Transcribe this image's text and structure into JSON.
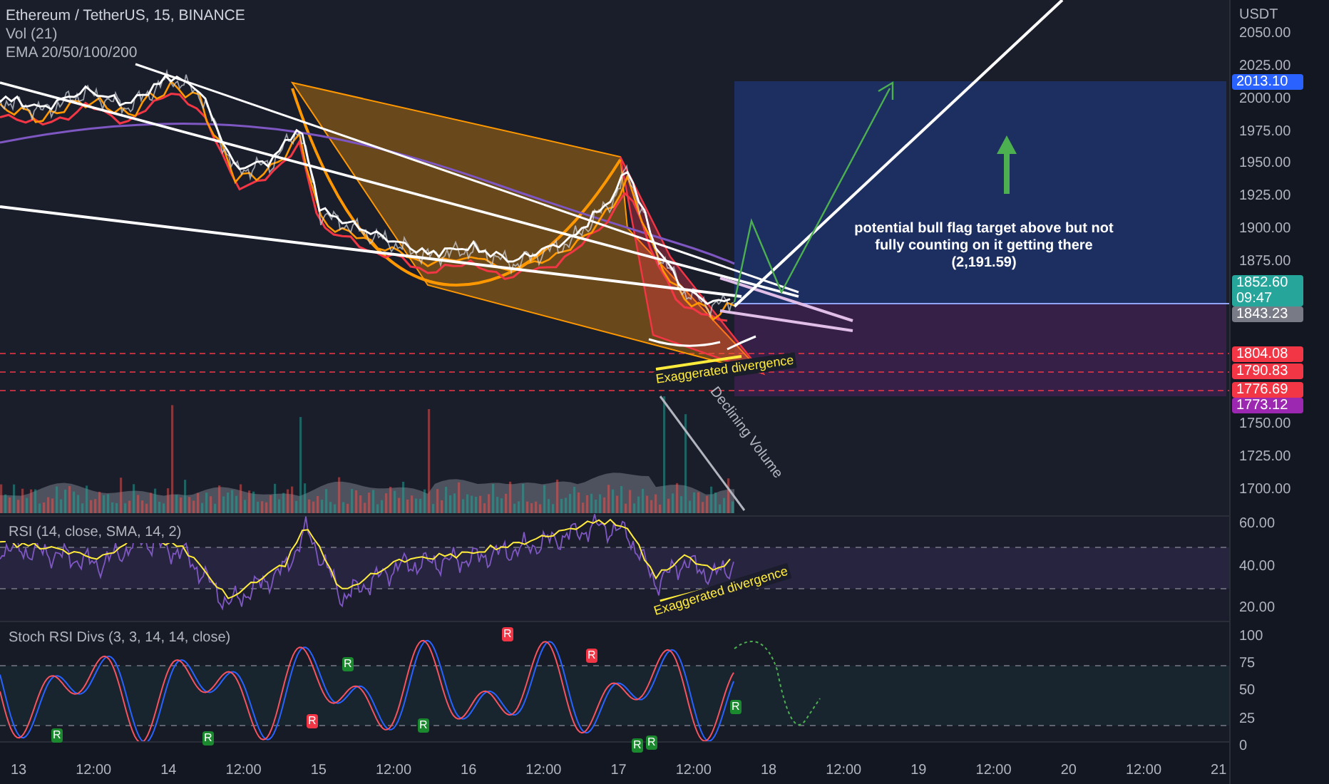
{
  "legend": {
    "title": "Ethereum / TetherUS, 15, BINANCE",
    "indicators": [
      "Vol (21)",
      "EMA 20/50/100/200"
    ]
  },
  "price_axis": {
    "currency": "USDT",
    "ticks": [
      "2050.00",
      "2025.00",
      "2000.00",
      "1975.00",
      "1950.00",
      "1925.00",
      "1900.00",
      "1875.00",
      "1750.00",
      "1725.00",
      "1700.00"
    ]
  },
  "price_badges": [
    {
      "text": "2013.10",
      "color": "#2962ff"
    },
    {
      "text": "1852.60",
      "subtext": "09:47",
      "color": "#26a69a"
    },
    {
      "text": "1843.23",
      "color": "#787b86"
    },
    {
      "text": "1804.08",
      "color": "#f23645"
    },
    {
      "text": "1790.83",
      "color": "#f23645"
    },
    {
      "text": "1776.69",
      "color": "#f23645"
    },
    {
      "text": "1773.12",
      "color": "#9c27b0"
    }
  ],
  "annotations": [
    {
      "kind": "note",
      "lines": [
        "potential bull flag target above but not",
        "fully counting on it getting there",
        "(2,191.59)"
      ]
    },
    {
      "kind": "divergence",
      "text": "Exaggerated divergence"
    },
    {
      "kind": "volume",
      "text": "Declining Volume"
    },
    {
      "kind": "rsi-divergence",
      "text": "Exaggerated divergence"
    }
  ],
  "rsi": {
    "label": "RSI (14, close, SMA, 14, 2)",
    "ticks": [
      "60.00",
      "40.00",
      "20.00"
    ]
  },
  "stoch": {
    "label": "Stoch RSI Divs (3, 3, 14, 14, close)",
    "ticks": [
      "100",
      "75",
      "50",
      "25",
      "0"
    ],
    "markers": [
      {
        "text": "R",
        "kind": "bullish"
      },
      {
        "text": "R",
        "kind": "bullish"
      },
      {
        "text": "R",
        "kind": "bearish"
      },
      {
        "text": "R",
        "kind": "bullish"
      },
      {
        "text": "R",
        "kind": "bullish"
      },
      {
        "text": "R",
        "kind": "bearish"
      },
      {
        "text": "R",
        "kind": "bearish"
      },
      {
        "text": "R",
        "kind": "bullish"
      },
      {
        "text": "R",
        "kind": "bullish"
      },
      {
        "text": "R",
        "kind": "bullish"
      }
    ]
  },
  "time_axis": {
    "ticks": [
      "13",
      "12:00",
      "14",
      "12:00",
      "15",
      "12:00",
      "16",
      "12:00",
      "17",
      "12:00",
      "18",
      "12:00",
      "19",
      "12:00",
      "20",
      "12:00",
      "21"
    ]
  }
}
